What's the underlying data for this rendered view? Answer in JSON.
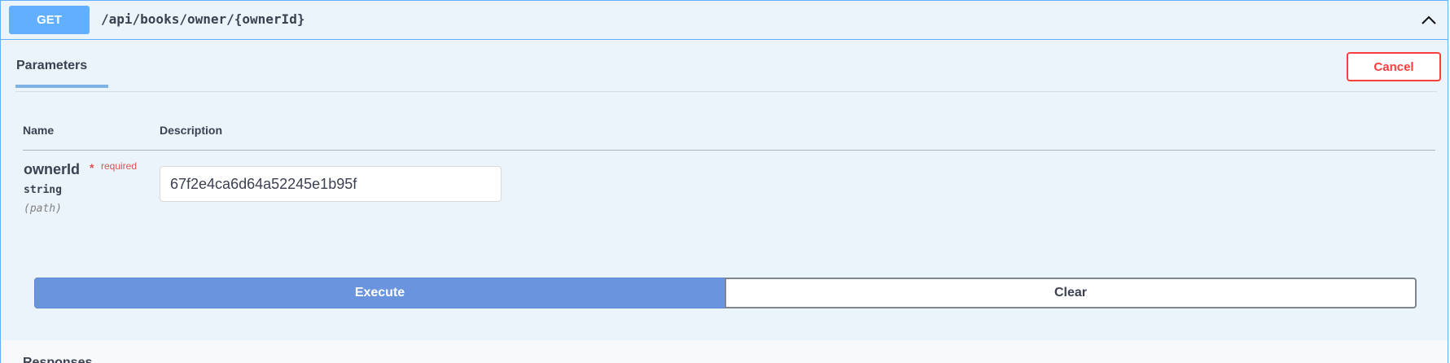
{
  "operation": {
    "method": "GET",
    "path": "/api/books/owner/{ownerId}",
    "collapse_icon": "chevron-up-icon"
  },
  "parameters_section": {
    "tab_label": "Parameters",
    "cancel_label": "Cancel",
    "columns": [
      "Name",
      "Description"
    ]
  },
  "parameter": {
    "name": "ownerId",
    "required_star": "*",
    "required_label": "required",
    "type": "string",
    "location": "(path)",
    "value": "67f2e4ca6d64a52245e1b95f"
  },
  "actions": {
    "execute_label": "Execute",
    "clear_label": "Clear"
  },
  "responses": {
    "title": "Responses"
  },
  "colors": {
    "get_accent": "#61affe",
    "panel_bg": "#ebf3fb",
    "cancel_red": "#f93e3e",
    "execute_blue": "#6a94de"
  }
}
